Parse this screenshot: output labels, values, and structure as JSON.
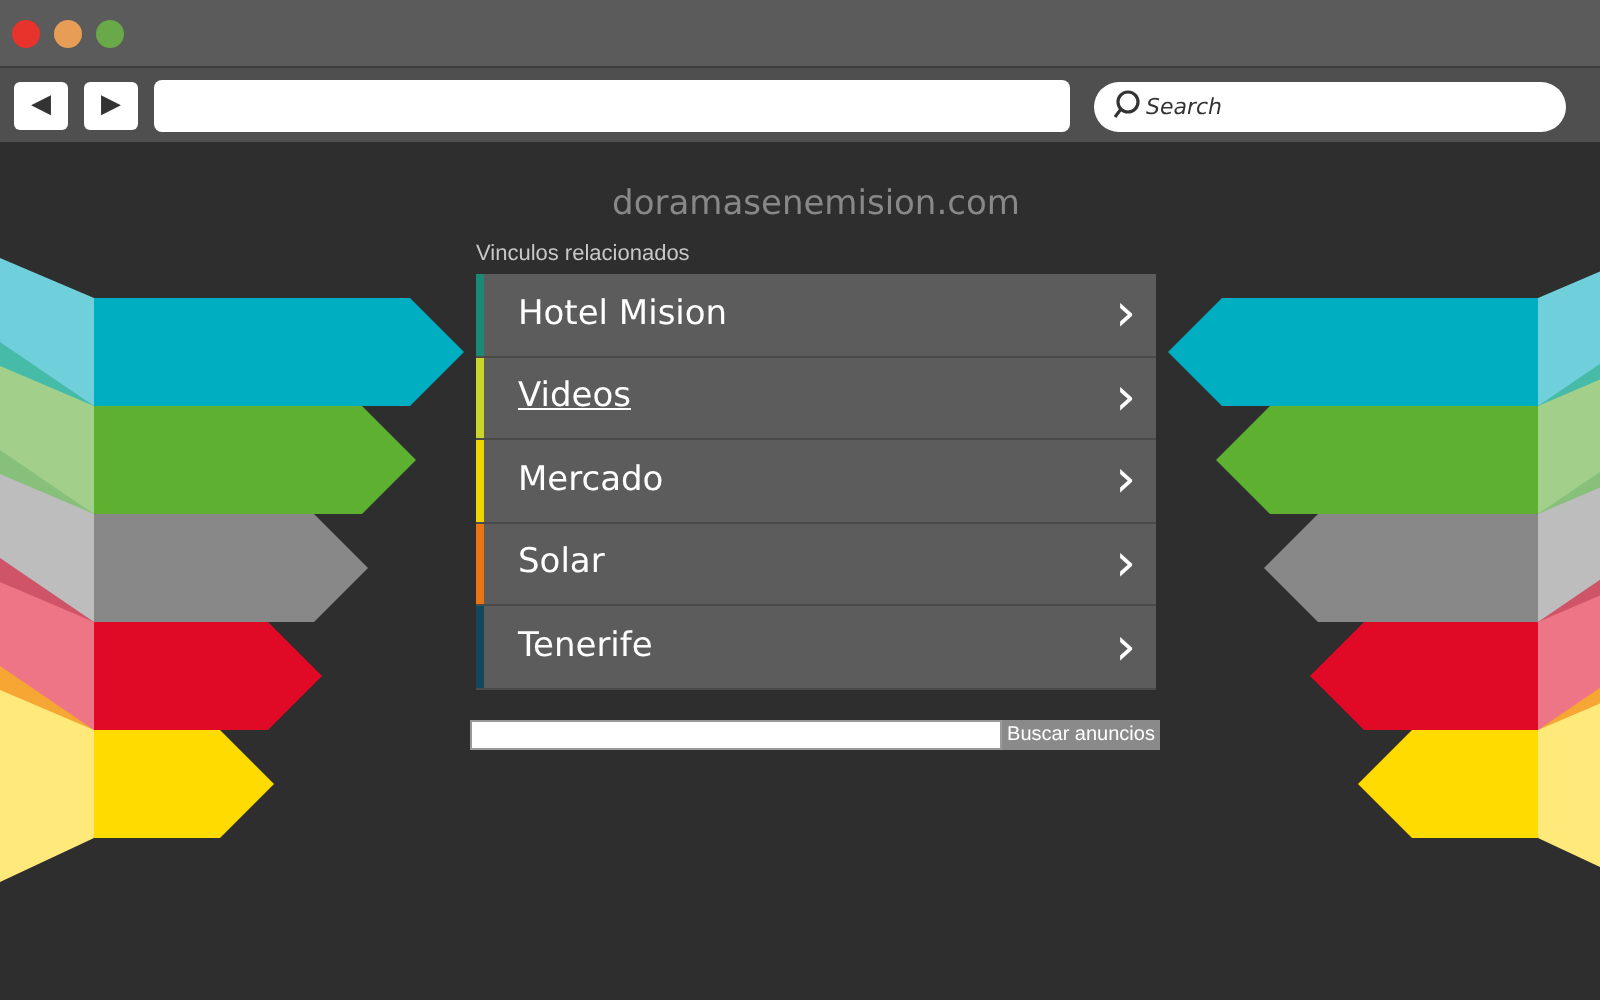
{
  "toolbar": {
    "back": "◀",
    "forward": "▶",
    "search": {
      "placeholder": "Search"
    }
  },
  "domain": "doramasenemision.com",
  "links_heading": "Vinculos relacionados",
  "links": [
    {
      "label": "Hotel Mision",
      "color": "#1a8a74",
      "underlined": false,
      "arrow": "›"
    },
    {
      "label": "Videos",
      "color": "#c8d62a",
      "underlined": true,
      "arrow": "›"
    },
    {
      "label": "Mercado",
      "color": "#f0d400",
      "underlined": false,
      "arrow": "›"
    },
    {
      "label": "Solar",
      "color": "#e87511",
      "underlined": false,
      "arrow": "›"
    },
    {
      "label": "Tenerife",
      "color": "#0f4a5c",
      "underlined": false,
      "arrow": "›"
    }
  ],
  "ad_search": {
    "button": "Buscar anuncios"
  }
}
